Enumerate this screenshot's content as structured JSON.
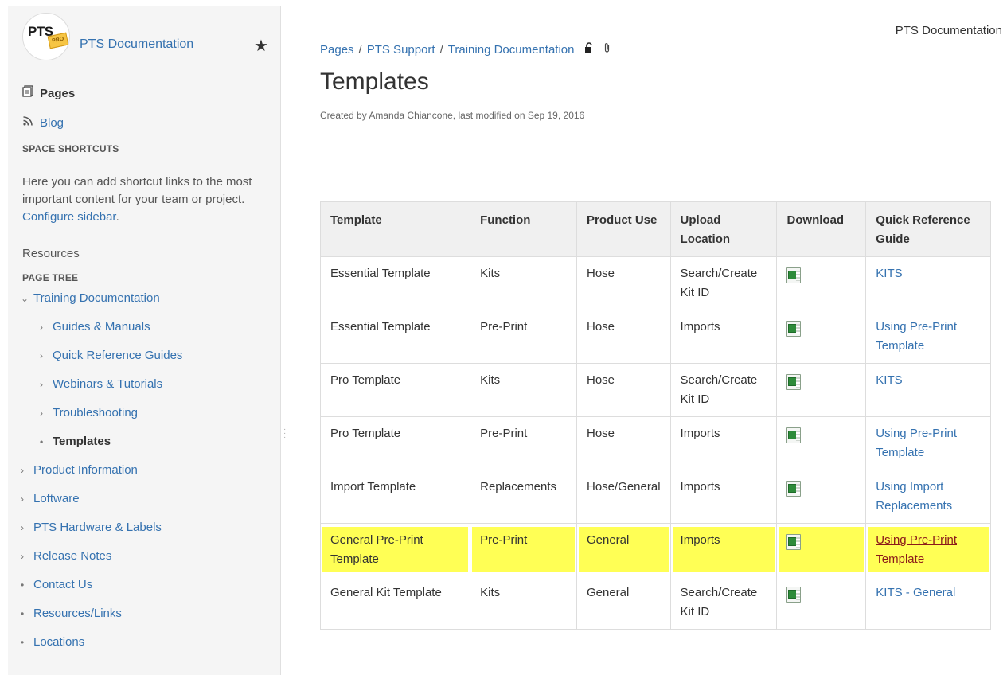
{
  "space": {
    "logo_text": "PTS",
    "logo_badge": "PRO",
    "name": "PTS Documentation"
  },
  "nav": {
    "pages_label": "Pages",
    "blog_label": "Blog"
  },
  "shortcuts": {
    "title": "SPACE SHORTCUTS",
    "description": "Here you can add shortcut links to the most important content for your team or project.",
    "configure_link": "Configure sidebar",
    "resources": "Resources"
  },
  "page_tree": {
    "title": "PAGE TREE",
    "items": [
      {
        "label": "Training Documentation",
        "marker": "⌄",
        "indent": 1
      },
      {
        "label": "Guides & Manuals",
        "marker": "›",
        "indent": 2
      },
      {
        "label": "Quick Reference Guides",
        "marker": "›",
        "indent": 2
      },
      {
        "label": "Webinars & Tutorials",
        "marker": "›",
        "indent": 2
      },
      {
        "label": "Troubleshooting",
        "marker": "›",
        "indent": 2
      },
      {
        "label": "Templates",
        "marker": "•",
        "indent": 2,
        "current": true
      },
      {
        "label": "Product Information",
        "marker": "›",
        "indent": 1
      },
      {
        "label": "Loftware",
        "marker": "›",
        "indent": 1
      },
      {
        "label": "PTS Hardware & Labels",
        "marker": "›",
        "indent": 1
      },
      {
        "label": "Release Notes",
        "marker": "›",
        "indent": 1
      },
      {
        "label": "Contact Us",
        "marker": "•",
        "indent": 1
      },
      {
        "label": "Resources/Links",
        "marker": "•",
        "indent": 1
      },
      {
        "label": "Locations",
        "marker": "•",
        "indent": 1
      }
    ]
  },
  "header": {
    "space_link": "PTS Documentation"
  },
  "breadcrumb": [
    "Pages",
    "PTS Support",
    "Training Documentation"
  ],
  "page": {
    "title": "Templates",
    "meta": "Created by Amanda Chiancone, last modified on Sep 19, 2016"
  },
  "table": {
    "headers": [
      "Template",
      "Function",
      "Product Use",
      "Upload Location",
      "Download",
      "Quick Reference Guide"
    ],
    "rows": [
      {
        "template": "Essential Template",
        "function": "Kits",
        "product_use": "Hose",
        "upload": "Search/Create Kit ID",
        "download_icon": "excel-file-icon",
        "guide": "KITS"
      },
      {
        "template": "Essential Template",
        "function": "Pre-Print",
        "product_use": "Hose",
        "upload": "Imports",
        "download_icon": "excel-file-icon",
        "guide": "Using Pre-Print Template"
      },
      {
        "template": "Pro Template",
        "function": "Kits",
        "product_use": "Hose",
        "upload": "Search/Create Kit ID",
        "download_icon": "excel-file-icon",
        "guide": "KITS"
      },
      {
        "template": "Pro Template",
        "function": "Pre-Print",
        "product_use": "Hose",
        "upload": "Imports",
        "download_icon": "excel-file-icon",
        "guide": "Using Pre-Print Template"
      },
      {
        "template": "Import Template",
        "function": "Replacements",
        "product_use": "Hose/General",
        "upload": "Imports",
        "download_icon": "excel-file-icon",
        "guide": "Using Import Replacements"
      },
      {
        "template": "General Pre-Print Template",
        "function": "Pre-Print",
        "product_use": "General",
        "upload": "Imports",
        "download_icon": "excel-file-icon",
        "guide": "Using Pre-Print Template",
        "highlighted": true
      },
      {
        "template": "General Kit Template",
        "function": "Kits",
        "product_use": "General",
        "upload": "Search/Create Kit ID",
        "download_icon": "excel-file-icon",
        "guide": "KITS - General"
      }
    ]
  },
  "colors": {
    "link": "#3572b0",
    "highlight": "#ffff55",
    "sidebar_bg": "#f5f5f5",
    "table_header_bg": "#f0f0f0"
  }
}
